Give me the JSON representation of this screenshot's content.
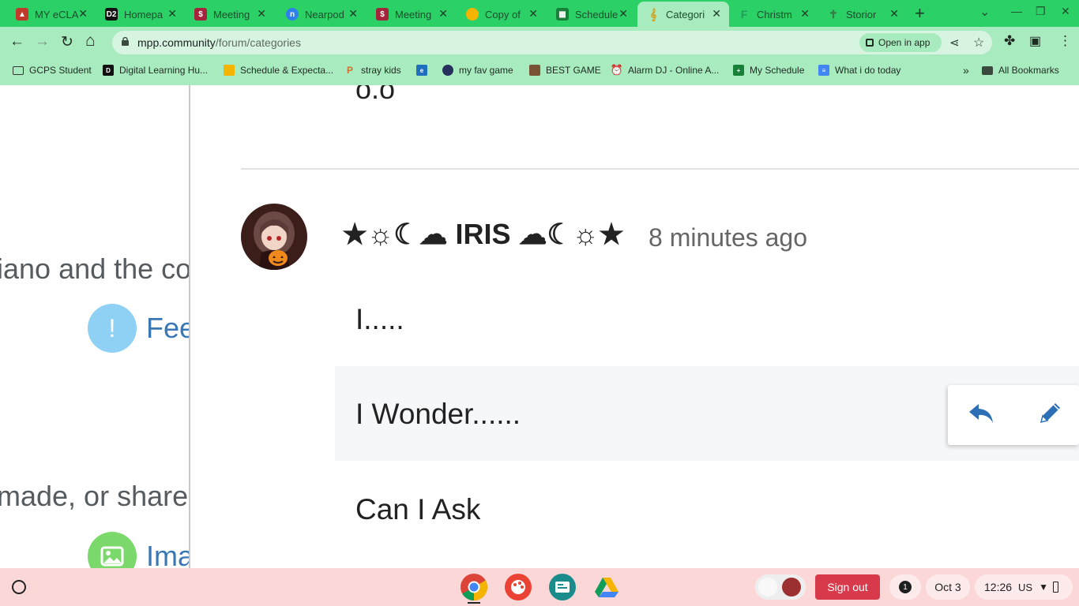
{
  "browser": {
    "tabs": [
      {
        "title": "MY eCLA",
        "icon": "eclass-icon",
        "color": "#c0392b"
      },
      {
        "title": "Homepa",
        "icon": "d2l-icon",
        "color": "#111111"
      },
      {
        "title": "Meeting",
        "icon": "meeting-icon",
        "color": "#a3243b"
      },
      {
        "title": "Nearpod",
        "icon": "nearpod-icon",
        "color": "#2f80ed"
      },
      {
        "title": "Meeting",
        "icon": "meeting-icon",
        "color": "#a3243b"
      },
      {
        "title": "Copy of",
        "icon": "slides-icon",
        "color": "#f4b400"
      },
      {
        "title": "Schedule",
        "icon": "sheets-icon",
        "color": "#188038"
      },
      {
        "title": "Categori",
        "icon": "mpp-icon",
        "color": "#d4a017"
      },
      {
        "title": "Christm",
        "icon": "forms-icon",
        "color": "#1e9c5b"
      },
      {
        "title": "Storior",
        "icon": "stories-icon",
        "color": "#3a7d44"
      }
    ],
    "active_tab": 7,
    "url_domain": "mpp.community",
    "url_path": "/forum/categories",
    "open_in_app": "Open in app",
    "bookmarks": [
      {
        "label": "GCPS Student",
        "icon": "folder-icon"
      },
      {
        "label": "Digital Learning Hu...",
        "icon": "d2l-icon"
      },
      {
        "label": "Schedule & Expecta...",
        "icon": "slides-icon"
      },
      {
        "label": "stray kids",
        "icon": "pinterest-icon"
      },
      {
        "label": "",
        "icon": "edge-icon"
      },
      {
        "label": "my fav game",
        "icon": "game-icon"
      },
      {
        "label": "BEST GAME",
        "icon": "game-face-icon"
      },
      {
        "label": "Alarm DJ - Online A...",
        "icon": "alarm-icon"
      },
      {
        "label": "My Schedule",
        "icon": "sheets-icon"
      },
      {
        "label": "What i do today",
        "icon": "docs-icon"
      }
    ],
    "all_bookmarks": "All Bookmarks"
  },
  "left_pane": {
    "desc1": "iano and the co",
    "cat1": "Fee",
    "desc2": "made, or share",
    "cat2": "Ima"
  },
  "post": {
    "previous_text": "o.o",
    "username": "★☼☾☁ IRIS ☁☾☼★",
    "time": "8 minutes ago",
    "lines": [
      "I.....",
      "I Wonder......",
      "Can I Ask"
    ],
    "highlight_line": 1
  },
  "taskbar": {
    "sign_out": "Sign out",
    "notifications": "1",
    "date": "Oct 3",
    "time": "12:26",
    "locale": "US"
  }
}
